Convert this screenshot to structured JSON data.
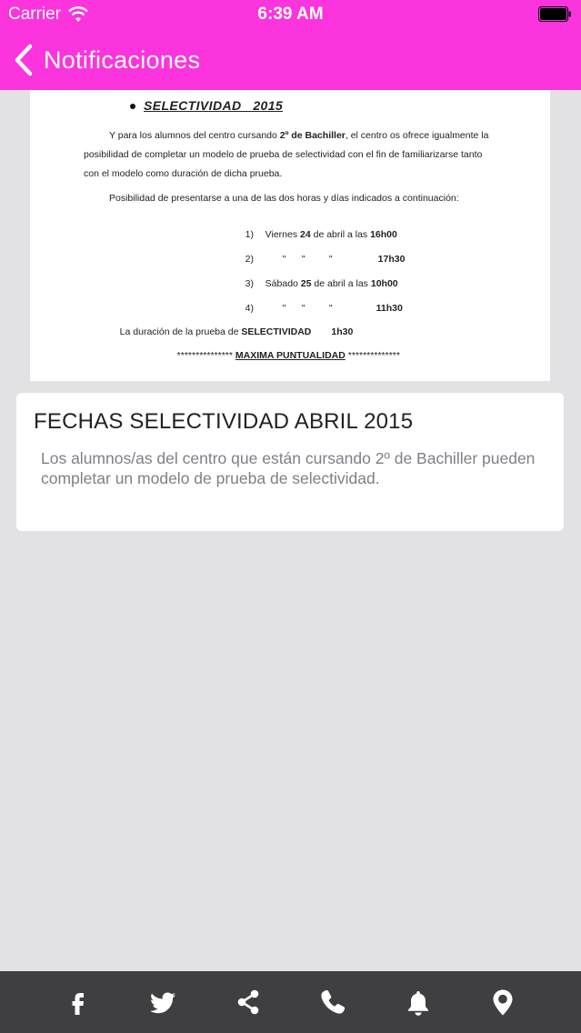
{
  "status_bar": {
    "carrier": "Carrier",
    "time": "6:39 AM"
  },
  "nav": {
    "back_label": "Notificaciones"
  },
  "document": {
    "title": "SELECTIVIDAD   2015",
    "intro_pre": "Y para los alumnos del centro cursando ",
    "intro_bold": "2º de Bachiller",
    "intro_post": ", el centro os ofrece igualmente la",
    "intro_line2": "posibilidad de completar un modelo de prueba de selectividad con el fin de familiarizarse tanto",
    "intro_line3": "con el modelo como duración de dicha prueba.",
    "options_intro": "Posibilidad de presentarse a una de las dos horas y días indicados a continuación:",
    "schedule": [
      {
        "num": "1)",
        "pre": "Viernes ",
        "day": "24",
        "mid": " de abril a las ",
        "hour": "16h00"
      },
      {
        "num": "2)",
        "pre": "\"      \"         \"",
        "day": "",
        "mid": "",
        "hour": "17h30"
      },
      {
        "num": "3)",
        "pre": "Sábado ",
        "day": "25",
        "mid": " de abril a las ",
        "hour": "10h00"
      },
      {
        "num": "4)",
        "pre": "\"      \"         \"",
        "day": "",
        "mid": "",
        "hour": "11h30"
      }
    ],
    "duration_pre": "La duración de la prueba de ",
    "duration_bold": "SELECTIVIDAD",
    "duration_value": "1h30",
    "punctuality_stars": "***************",
    "punctuality_label": "MAXIMA PUNTUALIDAD",
    "punctuality_stars_end": "**************"
  },
  "card": {
    "title": "FECHAS SELECTIVIDAD ABRIL 2015",
    "text": "Los alumnos/as del centro que están cursando 2º de Bachiller pueden completar un modelo de prueba de selectividad."
  },
  "tabbar": {
    "icons": [
      "facebook-icon",
      "twitter-icon",
      "share-icon",
      "phone-icon",
      "bell-icon",
      "location-pin-icon"
    ]
  },
  "colors": {
    "header": "#fb34de",
    "background": "#e2e1e4",
    "tabbar": "#3f3f42",
    "card_text": "#7f7f88"
  }
}
